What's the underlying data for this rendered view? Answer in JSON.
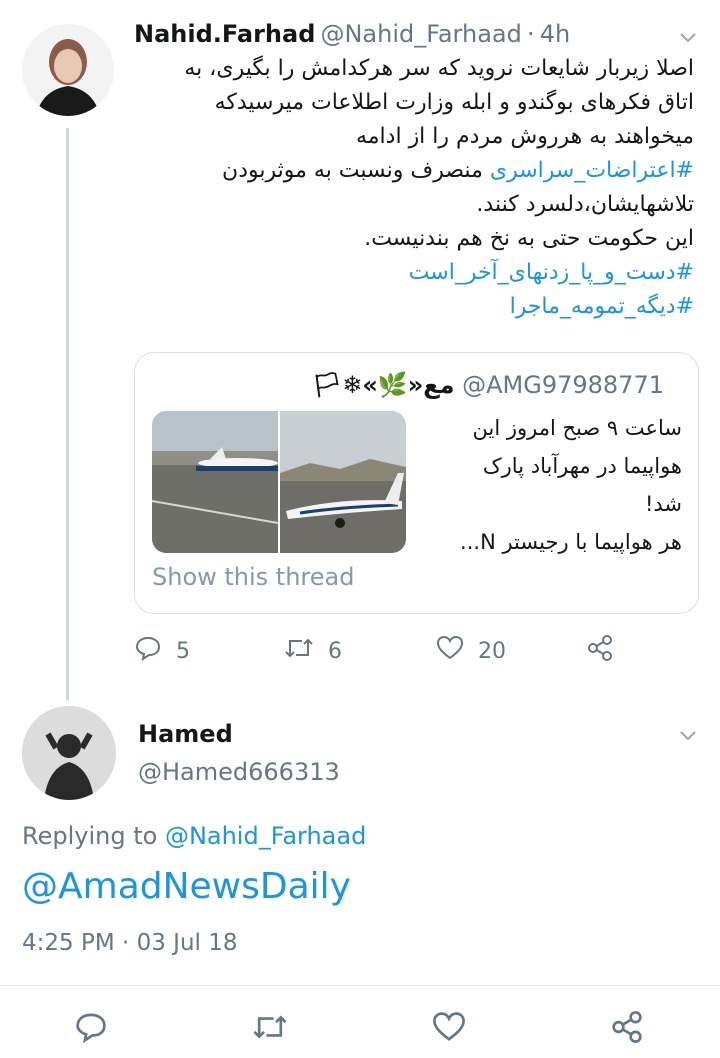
{
  "tweet": {
    "author_name": "Nahid.Farhad",
    "author_handle": "@Nahid_Farhaad",
    "time_sep": "·",
    "time": "4h",
    "text_lines": [
      "اصلا زیربار شایعات نروید که سر هرکدامش را بگیری، به",
      "اتاق فکرهای بوگندو و ابله وزارت اطلاعات میرسیدکه",
      "میخواهند به هرروش مردم را از ادامه"
    ],
    "hashtag_inline": "#اعتراضات_سراسری",
    "text_after_hashtag": " منصرف ونسبت به موثربودن",
    "text_lines_2": [
      "تلاشهایشان،دلسرد کنند.",
      "این حکومت حتی به نخ هم بندنیست."
    ],
    "hashtags": [
      "#دست_و_پا_زدنهای_آخر_است",
      "#دیگه_تمومه_ماجرا"
    ],
    "quote": {
      "name_glyphs": "🏳❄«🌿»مع",
      "handle": "@AMG97988771",
      "text_lines": [
        "ساعت ۹ صبح امروز این",
        "هواپیما در مهرآباد پارک",
        "شد!",
        "هر هواپیما با رجیستر N..."
      ],
      "show_thread": "Show this thread"
    },
    "stats": {
      "replies": "5",
      "retweets": "6",
      "likes": "20"
    }
  },
  "reply": {
    "author_name": "Hamed",
    "author_handle": "@Hamed666313",
    "replying_prefix": "Replying to ",
    "replying_to": "@Nahid_Farhaad",
    "body_mention": "@AmadNewsDaily",
    "timestamp": "4:25 PM · 03 Jul 18"
  },
  "colors": {
    "link": "#1b95e0",
    "muted": "#657786",
    "border": "#d8e0e6"
  },
  "icons": [
    "chevron-down-icon",
    "reply-icon",
    "retweet-icon",
    "like-icon",
    "share-icon"
  ]
}
